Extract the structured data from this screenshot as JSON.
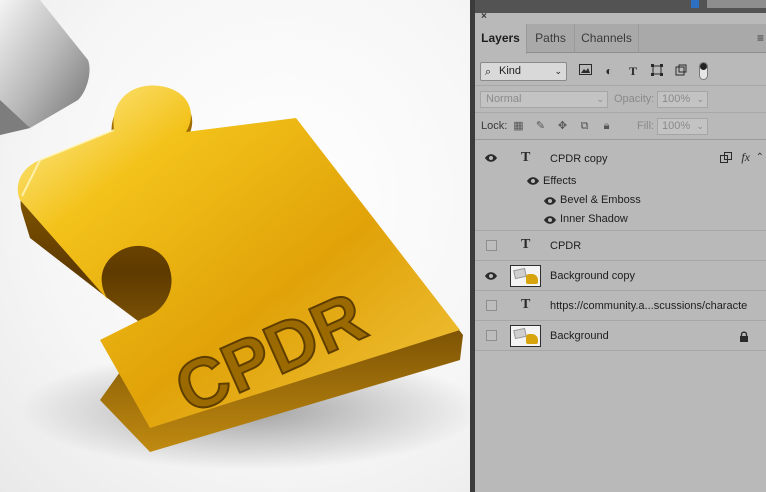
{
  "canvas": {
    "artwork_text": "CPDR",
    "colors": {
      "gold": "#e8b10c",
      "gold_dark": "#8a5a00",
      "background": "#f5f5f5"
    }
  },
  "panel": {
    "close_icon": "×",
    "menu_icon": "≡",
    "tabs": [
      {
        "label": "Layers",
        "active": true
      },
      {
        "label": "Paths",
        "active": false
      },
      {
        "label": "Channels",
        "active": false
      }
    ],
    "filter": {
      "kind_label": "Kind",
      "icons": [
        "image-filter-icon",
        "adjustment-filter-icon",
        "type-filter-icon",
        "shape-filter-icon",
        "smart-object-filter-icon"
      ]
    },
    "blend_mode": "Normal",
    "opacity_label": "Opacity:",
    "opacity_value": "100%",
    "lock_label": "Lock:",
    "fill_label": "Fill:",
    "fill_value": "100%"
  },
  "layers": [
    {
      "name": "CPDR copy",
      "type": "text",
      "visible": true,
      "has_fx": true,
      "fx_label": "fx",
      "effects_label": "Effects",
      "effects": [
        "Bevel & Emboss",
        "Inner Shadow"
      ]
    },
    {
      "name": "CPDR",
      "type": "text",
      "visible": false
    },
    {
      "name": "Background copy",
      "type": "image",
      "visible": true
    },
    {
      "name": "https://community.a...scussions/characte",
      "type": "text",
      "visible": false
    },
    {
      "name": "Background",
      "type": "image",
      "visible": false,
      "locked": true
    }
  ],
  "colors": {
    "panel_bg": "#b9b9b9",
    "tab_bar": "#a9a9a9",
    "divider": "#3c3c3c"
  }
}
